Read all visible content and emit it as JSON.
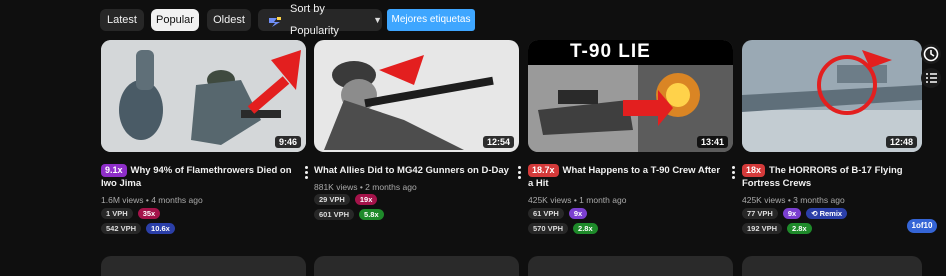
{
  "filters": {
    "latest": "Latest",
    "popular": "Popular",
    "oldest": "Oldest"
  },
  "sort": {
    "label": "Sort by Popularity"
  },
  "tags_button": "Mejores etiquetas",
  "videos": [
    {
      "duration": "9:46",
      "outlier": "9.1x",
      "outlier_color": "#8e2ec9",
      "title": "Why 94% of Flamethrowers Died on Iwo Jima",
      "views": "1.6M views",
      "age": "4 months ago",
      "vph": "1 VPH",
      "vph_ratio": "35x",
      "vph2": "542 VPH",
      "vph2_ratio": "10.6x"
    },
    {
      "duration": "12:54",
      "outlier": "",
      "title": "What Allies Did to MG42 Gunners on D-Day",
      "views": "881K views",
      "age": "2 months ago",
      "vph": "29 VPH",
      "vph_ratio": "19x",
      "vph2": "601 VPH",
      "vph2_ratio": "5.8x"
    },
    {
      "duration": "13:41",
      "thumb_text": "T-90 LIE",
      "outlier": "18.7x",
      "outlier_color": "#d43a3a",
      "title": "What Happens to a T-90 Crew After a Hit",
      "views": "425K views",
      "age": "1 month ago",
      "vph": "61 VPH",
      "vph_ratio": "9x",
      "vph2": "570 VPH",
      "vph2_ratio": "2.8x"
    },
    {
      "duration": "12:48",
      "outlier": "18x",
      "outlier_color": "#d43a3a",
      "title": "The HORRORS of B-17 Flying Fortress Crews",
      "views": "425K views",
      "age": "3 months ago",
      "vph": "77 VPH",
      "vph_ratio": "9x",
      "remix": "Remix",
      "vph2": "192 VPH",
      "vph2_ratio": "2.8x"
    }
  ],
  "pager": "1of10",
  "icons": [
    "sort-icon",
    "chevron-down-icon",
    "more-vert-icon",
    "clock-icon",
    "list-icon",
    "remix-icon"
  ]
}
